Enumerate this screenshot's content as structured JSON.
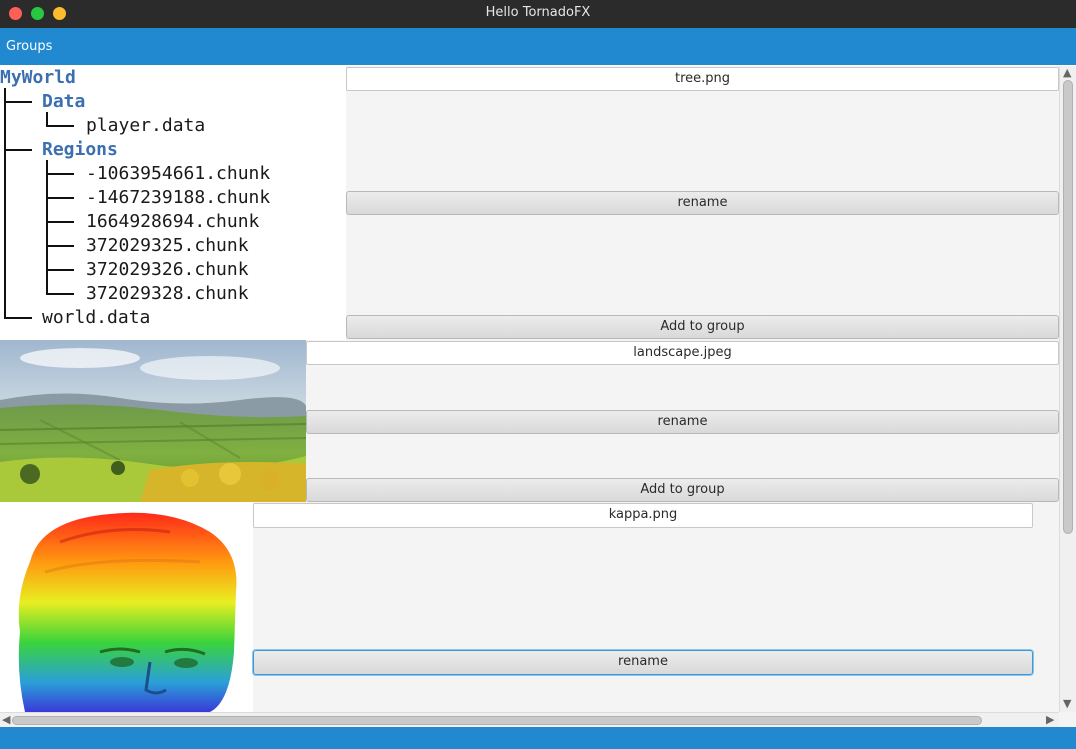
{
  "window": {
    "title": "Hello TornadoFX"
  },
  "menu": {
    "groups_label": "Groups"
  },
  "tree": {
    "root": "MyWorld",
    "data_folder": "Data",
    "player_data": "player.data",
    "regions_folder": "Regions",
    "chunks": [
      "-1063954661.chunk",
      "-1467239188.chunk",
      "1664928694.chunk",
      "372029325.chunk",
      "372029326.chunk",
      "372029328.chunk"
    ],
    "world_data": "world.data"
  },
  "items": {
    "tree": {
      "name": "tree.png",
      "rename": "rename",
      "add": "Add to group"
    },
    "landscape": {
      "name": "landscape.jpeg",
      "rename": "rename",
      "add": "Add to group"
    },
    "kappa": {
      "name": "kappa.png",
      "rename": "rename"
    }
  },
  "colors": {
    "accent": "#2089cf",
    "titlebar": "#2b2b2b",
    "tree_folder": "#3c6fb0"
  }
}
